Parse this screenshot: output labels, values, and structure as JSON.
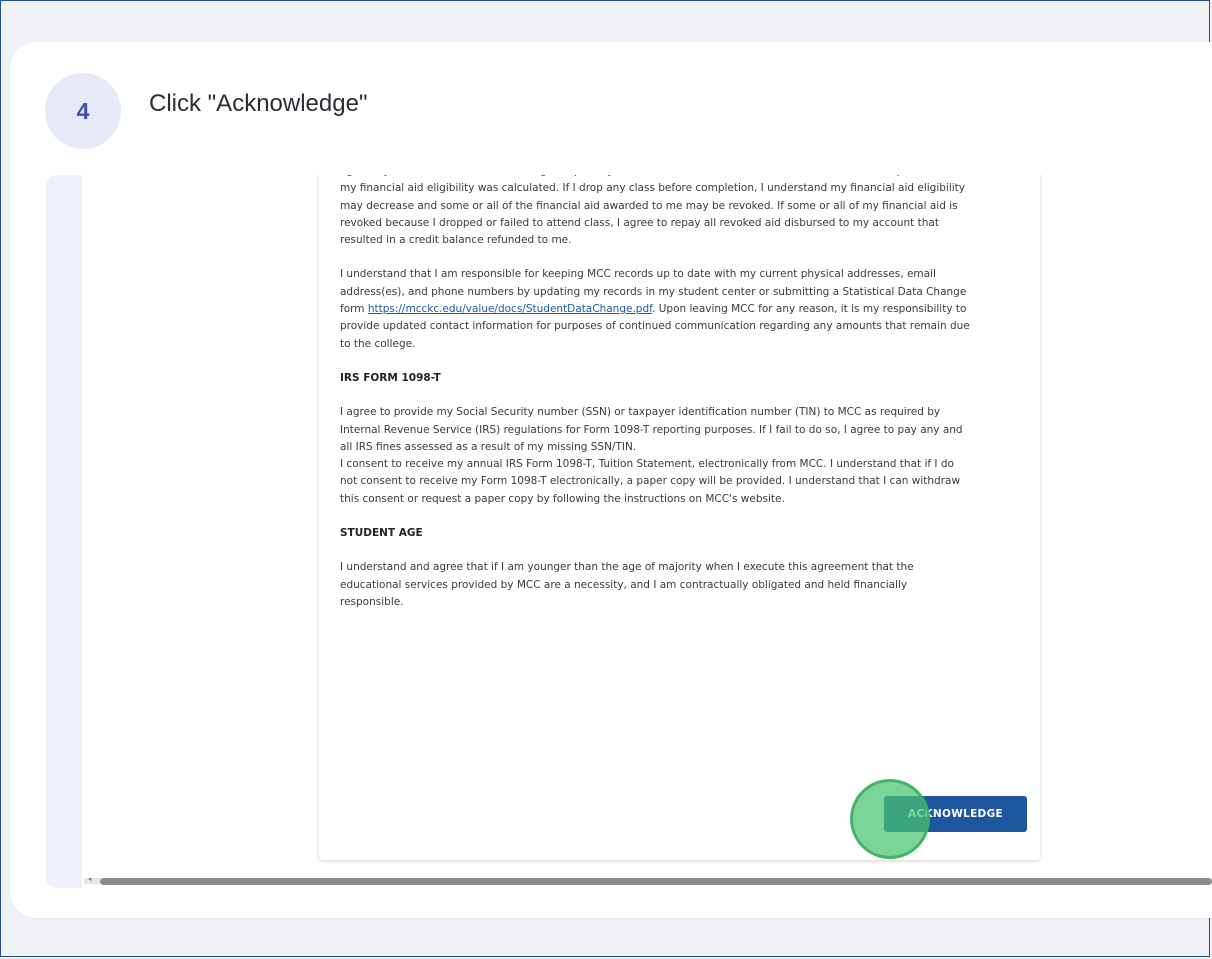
{
  "step": {
    "number": "4",
    "title": "Click \"Acknowledge\""
  },
  "document": {
    "para1": "agree my financial aid award is contingent upon my continued enrollment and attendance in each class upon which my financial aid eligibility was calculated. If I drop any class before completion, I understand my financial aid eligibility may decrease and some or all of the financial aid awarded to me may be revoked. If some or all of my financial aid is revoked because I dropped or failed to attend class, I agree to repay all revoked aid disbursed to my account that resulted in a credit balance refunded to me.",
    "para2_before_link": "I understand that I am responsible for keeping MCC records up to date with my current physical addresses, email address(es), and phone numbers by updating my records in my student center or submitting a Statistical Data Change form ",
    "para2_link": "https://mcckc.edu/value/docs/StudentDataChange.pdf",
    "para2_after_link": ". Upon leaving MCC for any reason, it is my responsibility to provide updated contact information for purposes of continued communication regarding any amounts that remain due to the college.",
    "heading_irs": "IRS FORM 1098-T",
    "para3": "I agree to provide my Social Security number (SSN) or taxpayer identification number (TIN) to MCC as required by Internal Revenue Service (IRS) regulations for Form 1098-T reporting purposes. If I fail to do so, I agree to pay any and all IRS fines assessed as a result of my missing SSN/TIN.",
    "para4": "I consent to receive my annual IRS Form 1098-T, Tuition Statement, electronically from MCC. I understand that if I do not consent to receive my Form 1098-T electronically, a paper copy will be provided. I understand that I can withdraw this consent or request a paper copy by following the instructions on MCC's website.",
    "heading_age": "STUDENT AGE",
    "para5": "I understand and agree that if I am younger than the age of majority when I execute this agreement that the educational services provided by MCC are a necessity, and I am contractually obligated and held financially responsible."
  },
  "buttons": {
    "acknowledge": "ACKNOWLEDGE"
  },
  "colors": {
    "accent": "#3f51b5",
    "button": "#1f56a0",
    "click_marker": "#48c470",
    "link": "#1b5aa6"
  }
}
